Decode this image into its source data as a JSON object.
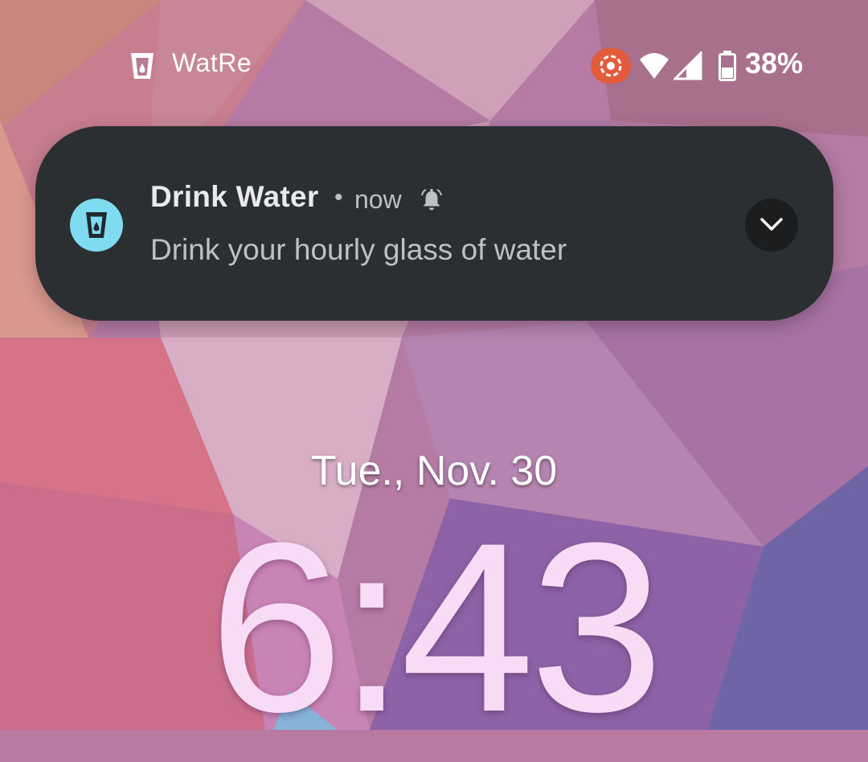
{
  "status_bar": {
    "app_name": "WatRe",
    "battery_percent": "38%",
    "icons": [
      "water-glass-icon",
      "screen-record-icon",
      "wifi-icon",
      "cell-signal-icon",
      "battery-icon"
    ],
    "record_color": "#e35b3a"
  },
  "notification": {
    "title": "Drink Water",
    "separator": "•",
    "time": "now",
    "text": "Drink your hourly glass of water",
    "icon": "water-glass-icon",
    "icon_bg_color": "#7fdcf0",
    "bg_color": "#2b2f32"
  },
  "lockscreen": {
    "date": "Tue., Nov. 30",
    "time": "6:43"
  }
}
